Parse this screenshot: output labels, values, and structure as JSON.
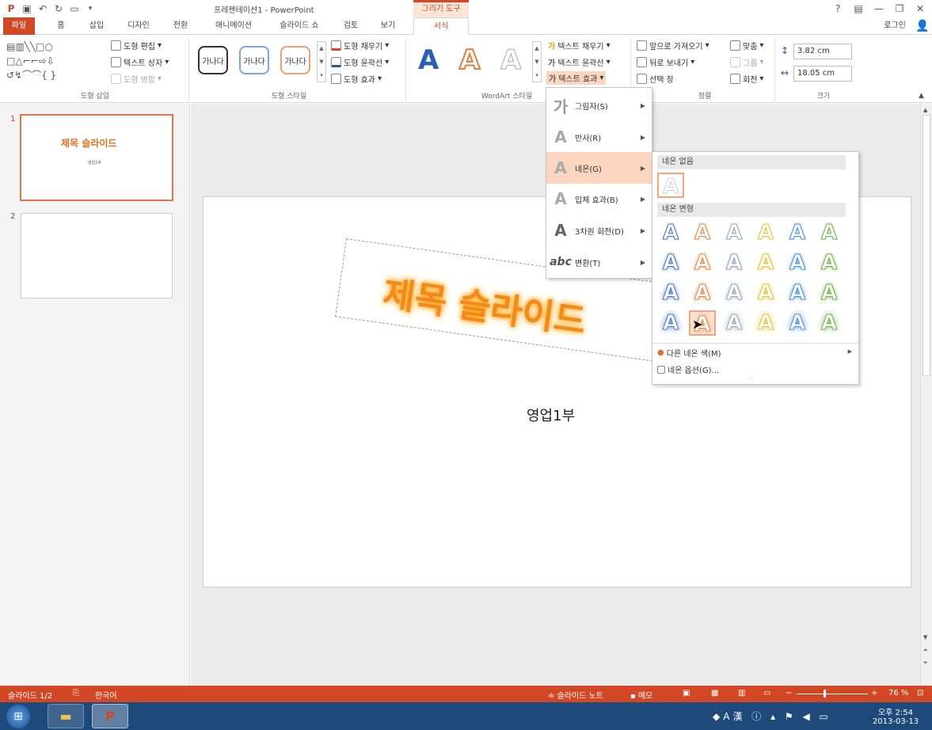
{
  "titlebar": {
    "title": "프레젠테이션1 - PowerPoint",
    "context_tab": "그리기 도구",
    "help": "?",
    "login": "로그인"
  },
  "tabs": [
    "파일",
    "홈",
    "삽입",
    "디자인",
    "전환",
    "애니메이션",
    "슬라이드 쇼",
    "검토",
    "보기",
    "서식"
  ],
  "ribbon": {
    "shapes_group": {
      "edit": "도형 편집",
      "textbox": "텍스트 상자",
      "merge": "도형 병합",
      "label": "도형 삽입"
    },
    "style_group": {
      "samples": [
        "가나다",
        "가나다",
        "가나다"
      ],
      "fill": "도형 채우기",
      "outline": "도형 윤곽선",
      "effects": "도형 효과",
      "label": "도형 스타일"
    },
    "wordart_group": {
      "text_fill": "텍스트 채우기",
      "text_outline": "텍스트 윤곽선",
      "text_effects": "텍스트 효과",
      "label": "WordArt 스타일"
    },
    "arrange_group": {
      "bring_forward": "앞으로 가져오기",
      "send_backward": "뒤로 보내기",
      "selection_pane": "선택 창",
      "align": "맞춤",
      "group": "그룹",
      "rotate": "회전",
      "label": "정렬"
    },
    "size_group": {
      "height": "3.82 cm",
      "width": "18.05 cm",
      "label": "크기"
    }
  },
  "text_effects_menu": {
    "items": [
      {
        "label": "그림자(S)",
        "glyph": "가"
      },
      {
        "label": "반사(R)",
        "glyph": "A"
      },
      {
        "label": "네온(G)",
        "glyph": "A"
      },
      {
        "label": "입체 효과(B)",
        "glyph": "A"
      },
      {
        "label": "3차원 회전(D)",
        "glyph": "A"
      },
      {
        "label": "변환(T)",
        "glyph": "abc"
      }
    ]
  },
  "neon_submenu": {
    "no_neon": "네온 없음",
    "variations": "네온 변형",
    "more_colors": "다른 네온 색(M)",
    "options": "네온 옵션(G)...",
    "colors": [
      "#4a78c4",
      "#e0894a",
      "#9aa6b8",
      "#e6c23a",
      "#4a8fd8",
      "#6fb24a"
    ]
  },
  "slides": {
    "numbers": [
      "1",
      "2"
    ],
    "thumb_title": "제목 슬라이드",
    "thumb_sub": "영업1부"
  },
  "slide": {
    "title": "제목 슬라이드",
    "subtitle": "영업1부"
  },
  "status": {
    "slide": "슬라이드 1/2",
    "lang": "한국어",
    "notes": "슬라이드 노트",
    "comments": "메모",
    "zoom": "76 %",
    "zoom_level": 0.76
  },
  "taskbar": {
    "time": "오후 2:54",
    "date": "2013-03-13"
  }
}
